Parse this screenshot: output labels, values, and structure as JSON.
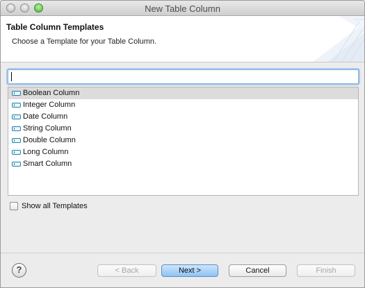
{
  "window": {
    "title": "New Table Column"
  },
  "banner": {
    "title": "Table Column Templates",
    "description": "Choose a Template for your Table Column."
  },
  "filter": {
    "value": "",
    "placeholder": ""
  },
  "templates": {
    "items": [
      {
        "label": "Boolean Column",
        "selected": true,
        "icon": "table-column-icon"
      },
      {
        "label": "Integer Column",
        "selected": false,
        "icon": "table-column-icon"
      },
      {
        "label": "Date Column",
        "selected": false,
        "icon": "table-column-icon"
      },
      {
        "label": "String Column",
        "selected": false,
        "icon": "table-column-icon"
      },
      {
        "label": "Double Column",
        "selected": false,
        "icon": "table-column-icon"
      },
      {
        "label": "Long Column",
        "selected": false,
        "icon": "table-column-icon"
      },
      {
        "label": "Smart Column",
        "selected": false,
        "icon": "table-column-icon"
      }
    ]
  },
  "show_all": {
    "label": "Show all Templates",
    "checked": false
  },
  "buttons": {
    "help": "?",
    "back": "< Back",
    "next": "Next >",
    "cancel": "Cancel",
    "finish": "Finish"
  }
}
